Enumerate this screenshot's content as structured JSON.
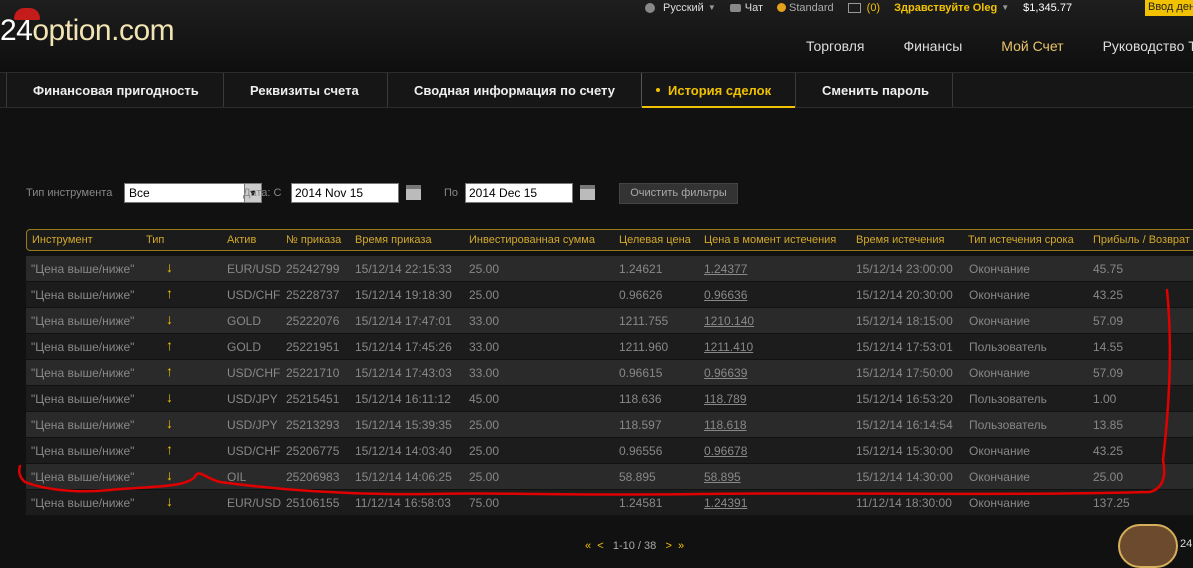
{
  "header": {
    "logo_num": "24",
    "logo_text": "option.com",
    "util": {
      "language": "Русский",
      "chat": "Чат",
      "account_type": "Standard",
      "messages": "(0)",
      "greeting": "Здравствуйте Oleg",
      "balance": "$1,345.77",
      "deposit": "Ввод денег"
    },
    "main_nav": [
      "Торговля",
      "Финансы",
      "Мой Счет",
      "Руководство Т"
    ],
    "main_nav_active": 2
  },
  "subnav": {
    "tabs": [
      "Финансовая пригодность",
      "Реквизиты счета",
      "Сводная информация по счету",
      "История сделок",
      "Сменить пароль"
    ],
    "active": 3
  },
  "filters": {
    "instrument_label": "Тип инструмента",
    "instrument_value": "Все",
    "date_label": "Дата: С",
    "date_from": "2014 Nov 15",
    "to_label": "По",
    "date_to": "2014 Dec 15",
    "clear_button": "Очистить фильтры"
  },
  "table": {
    "columns": [
      "Инструмент",
      "Тип",
      "Актив",
      "№ приказа",
      "Время приказа",
      "Инвестированная сумма",
      "Целевая цена",
      "Цена в момент истечения",
      "Время истечения",
      "Тип истечения срока",
      "Прибыль / Возврат"
    ],
    "rows": [
      {
        "instrument": "\"Цена выше/ниже\"",
        "type": "↓",
        "asset": "EUR/USD",
        "order": "25242799",
        "order_time": "15/12/14 22:15:33",
        "invested": "25.00",
        "target": "1.24621",
        "expiry_price": "1.24377",
        "expiry_time": "15/12/14 23:00:00",
        "expiry_type": "Окончание",
        "profit": "45.75"
      },
      {
        "instrument": "\"Цена выше/ниже\"",
        "type": "↑",
        "asset": "USD/CHF",
        "order": "25228737",
        "order_time": "15/12/14 19:18:30",
        "invested": "25.00",
        "target": "0.96626",
        "expiry_price": "0.96636",
        "expiry_time": "15/12/14 20:30:00",
        "expiry_type": "Окончание",
        "profit": "43.25"
      },
      {
        "instrument": "\"Цена выше/ниже\"",
        "type": "↓",
        "asset": "GOLD",
        "order": "25222076",
        "order_time": "15/12/14 17:47:01",
        "invested": "33.00",
        "target": "1211.755",
        "expiry_price": "1210.140",
        "expiry_time": "15/12/14 18:15:00",
        "expiry_type": "Окончание",
        "profit": "57.09"
      },
      {
        "instrument": "\"Цена выше/ниже\"",
        "type": "↑",
        "asset": "GOLD",
        "order": "25221951",
        "order_time": "15/12/14 17:45:26",
        "invested": "33.00",
        "target": "1211.960",
        "expiry_price": "1211.410",
        "expiry_time": "15/12/14 17:53:01",
        "expiry_type": "Пользователь",
        "profit": "14.55"
      },
      {
        "instrument": "\"Цена выше/ниже\"",
        "type": "↑",
        "asset": "USD/CHF",
        "order": "25221710",
        "order_time": "15/12/14 17:43:03",
        "invested": "33.00",
        "target": "0.96615",
        "expiry_price": "0.96639",
        "expiry_time": "15/12/14 17:50:00",
        "expiry_type": "Окончание",
        "profit": "57.09"
      },
      {
        "instrument": "\"Цена выше/ниже\"",
        "type": "↓",
        "asset": "USD/JPY",
        "order": "25215451",
        "order_time": "15/12/14 16:11:12",
        "invested": "45.00",
        "target": "118.636",
        "expiry_price": "118.789",
        "expiry_time": "15/12/14 16:53:20",
        "expiry_type": "Пользователь",
        "profit": "1.00"
      },
      {
        "instrument": "\"Цена выше/ниже\"",
        "type": "↓",
        "asset": "USD/JPY",
        "order": "25213293",
        "order_time": "15/12/14 15:39:35",
        "invested": "25.00",
        "target": "118.597",
        "expiry_price": "118.618",
        "expiry_time": "15/12/14 16:14:54",
        "expiry_type": "Пользователь",
        "profit": "13.85"
      },
      {
        "instrument": "\"Цена выше/ниже\"",
        "type": "↑",
        "asset": "USD/CHF",
        "order": "25206775",
        "order_time": "15/12/14 14:03:40",
        "invested": "25.00",
        "target": "0.96556",
        "expiry_price": "0.96678",
        "expiry_time": "15/12/14 15:30:00",
        "expiry_type": "Окончание",
        "profit": "43.25"
      },
      {
        "instrument": "\"Цена выше/ниже\"",
        "type": "↓",
        "asset": "OIL",
        "order": "25206983",
        "order_time": "15/12/14 14:06:25",
        "invested": "25.00",
        "target": "58.895",
        "expiry_price": "58.895",
        "expiry_time": "15/12/14 14:30:00",
        "expiry_type": "Окончание",
        "profit": "25.00"
      },
      {
        "instrument": "\"Цена выше/ниже\"",
        "type": "↓",
        "asset": "EUR/USD",
        "order": "25106155",
        "order_time": "11/12/14 16:58:03",
        "invested": "75.00",
        "target": "1.24581",
        "expiry_price": "1.24391",
        "expiry_time": "11/12/14 18:30:00",
        "expiry_type": "Окончание",
        "profit": "137.25"
      }
    ]
  },
  "pager": {
    "first": "«",
    "prev": "<",
    "range": "1-10 / 38",
    "next": ">",
    "last": "»"
  },
  "chat_widget": {
    "label": "24"
  },
  "colors": {
    "accent": "#f2c200",
    "annotation": "#e00000"
  }
}
